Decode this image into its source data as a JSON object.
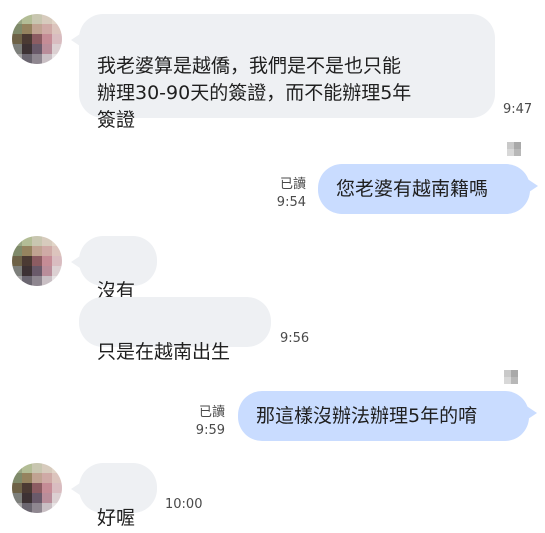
{
  "messages": [
    {
      "text": "我老婆算是越僑，我們是不是也只能\n辦理30-90天的簽證，而不能辦理5年\n簽證",
      "time": "9:47"
    },
    {
      "text": "您老婆有越南籍嗎",
      "read": "已讀",
      "time": "9:54"
    },
    {
      "text": "沒有"
    },
    {
      "text": "只是在越南出生",
      "time": "9:56"
    },
    {
      "text": "那這樣沒辦法辦理5年的唷",
      "read": "已讀",
      "time": "9:59"
    },
    {
      "text": "好喔",
      "time": "10:00"
    }
  ]
}
